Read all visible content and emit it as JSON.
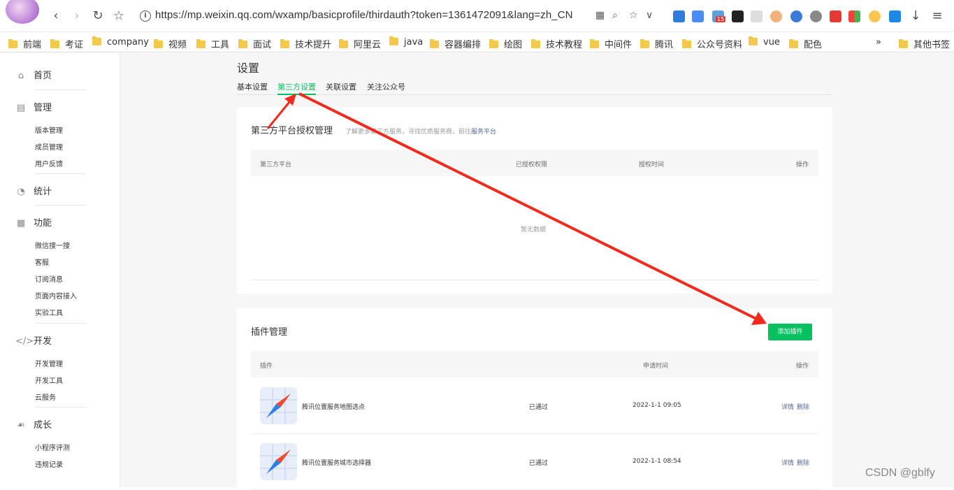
{
  "browser": {
    "url": "https://mp.weixin.qq.com/wxamp/basicprofile/thirdauth?token=1361472091&lang=zh_CN",
    "ext_badge": "15"
  },
  "bookmarks": [
    "前端",
    "考证",
    "company",
    "视频",
    "工具",
    "面试",
    "技术提升",
    "阿里云",
    "java",
    "容器编排",
    "绘图",
    "技术教程",
    "中间件",
    "腾讯",
    "公众号资料",
    "vue",
    "配色"
  ],
  "bookmarks_more": "»",
  "bookmarks_other": "其他书签",
  "sidebar": {
    "home": "首页",
    "manage": "管理",
    "manage_items": [
      "版本管理",
      "成员管理",
      "用户反馈"
    ],
    "stats": "统计",
    "feature": "功能",
    "feature_items": [
      "微信搜一搜",
      "客服",
      "订阅消息",
      "页面内容接入",
      "实验工具"
    ],
    "dev": "开发",
    "dev_items": [
      "开发管理",
      "开发工具",
      "云服务"
    ],
    "growth": "成长",
    "growth_items": [
      "小程序评测",
      "违规记录"
    ]
  },
  "page": {
    "title": "设置",
    "tabs": [
      "基本设置",
      "第三方设置",
      "关联设置",
      "关注公众号"
    ],
    "active_tab": 1
  },
  "third_party": {
    "title": "第三方平台授权管理",
    "desc": "了解更多第三方服务，寻找优质服务商，前往",
    "desc_link": "服务平台",
    "columns": [
      "第三方平台",
      "已授权权限",
      "授权时间",
      "操作"
    ],
    "empty": "暂无数据"
  },
  "plugins": {
    "title": "插件管理",
    "add_button": "添加插件",
    "columns": [
      "插件",
      "申请时间",
      "操作"
    ],
    "rows": [
      {
        "name": "腾讯位置服务地图选点",
        "status": "已通过",
        "time": "2022-1-1 09:05",
        "detail": "详情",
        "delete": "删除"
      },
      {
        "name": "腾讯位置服务城市选择器",
        "status": "已通过",
        "time": "2022-1-1 08:54",
        "detail": "详情",
        "delete": "删除"
      }
    ]
  },
  "watermark": "CSDN @gblfy",
  "colors": {
    "accent": "#07c160",
    "link": "#576b95",
    "arrow": "#f02b1e"
  }
}
